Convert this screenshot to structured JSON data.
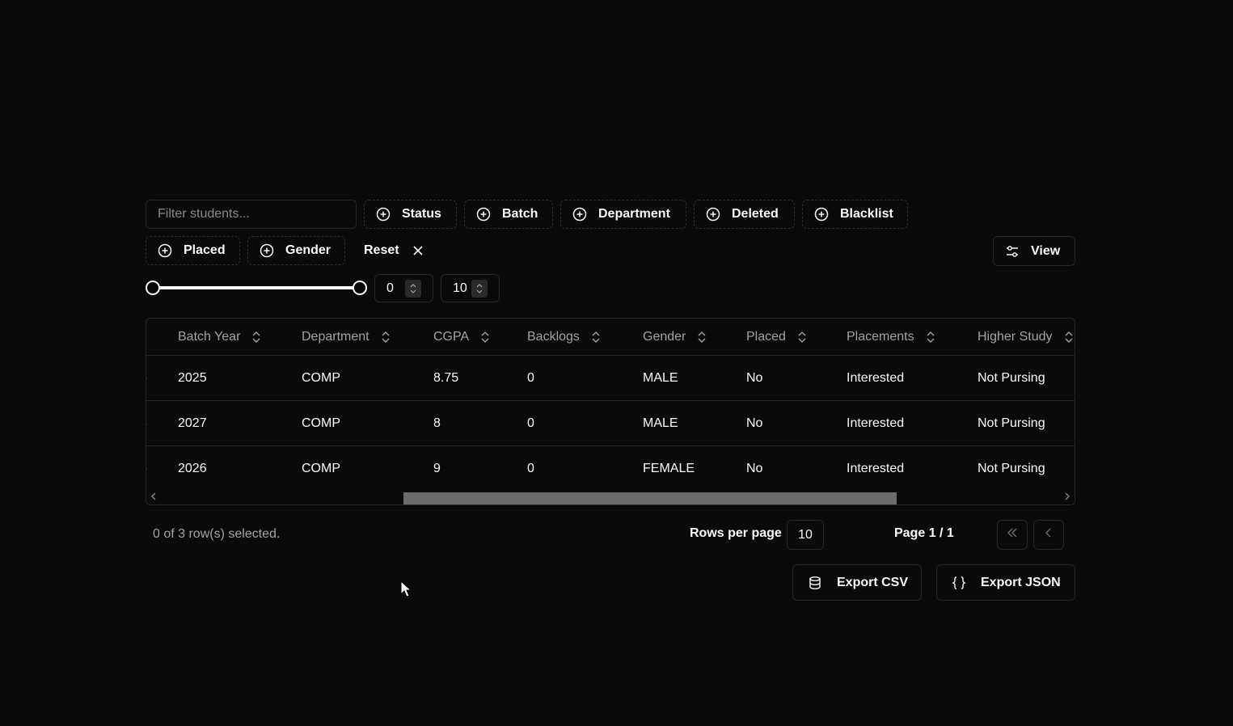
{
  "toolbar": {
    "search_placeholder": "Filter students...",
    "facets_row1": [
      "Status",
      "Batch",
      "Department",
      "Deleted",
      "Blacklist"
    ],
    "facets_row2": [
      "Placed",
      "Gender"
    ],
    "reset_label": "Reset",
    "view_label": "View"
  },
  "range": {
    "min_value": "0",
    "max_value": "10",
    "slider_low_fraction": 0,
    "slider_high_fraction": 1
  },
  "table": {
    "columns": [
      "Batch Year",
      "Department",
      "CGPA",
      "Backlogs",
      "Gender",
      "Placed",
      "Placements",
      "Higher Study"
    ],
    "rows": [
      {
        "cut": "6",
        "cells": [
          "2025",
          "COMP",
          "8.75",
          "0",
          "MALE",
          "No",
          "Interested",
          "Not Pursing"
        ]
      },
      {
        "cut": "3",
        "cells": [
          "2027",
          "COMP",
          "8",
          "0",
          "MALE",
          "No",
          "Interested",
          "Not Pursing"
        ]
      },
      {
        "cut": "5",
        "cells": [
          "2026",
          "COMP",
          "9",
          "0",
          "FEMALE",
          "No",
          "Interested",
          "Not Pursing"
        ]
      }
    ]
  },
  "footer": {
    "selection_text": "0 of 3 row(s) selected.",
    "rows_per_page_label": "Rows per page",
    "rows_per_page_value": "10",
    "page_label": "Page 1 / 1"
  },
  "export": {
    "csv_label": "Export CSV",
    "json_label": "Export JSON"
  }
}
